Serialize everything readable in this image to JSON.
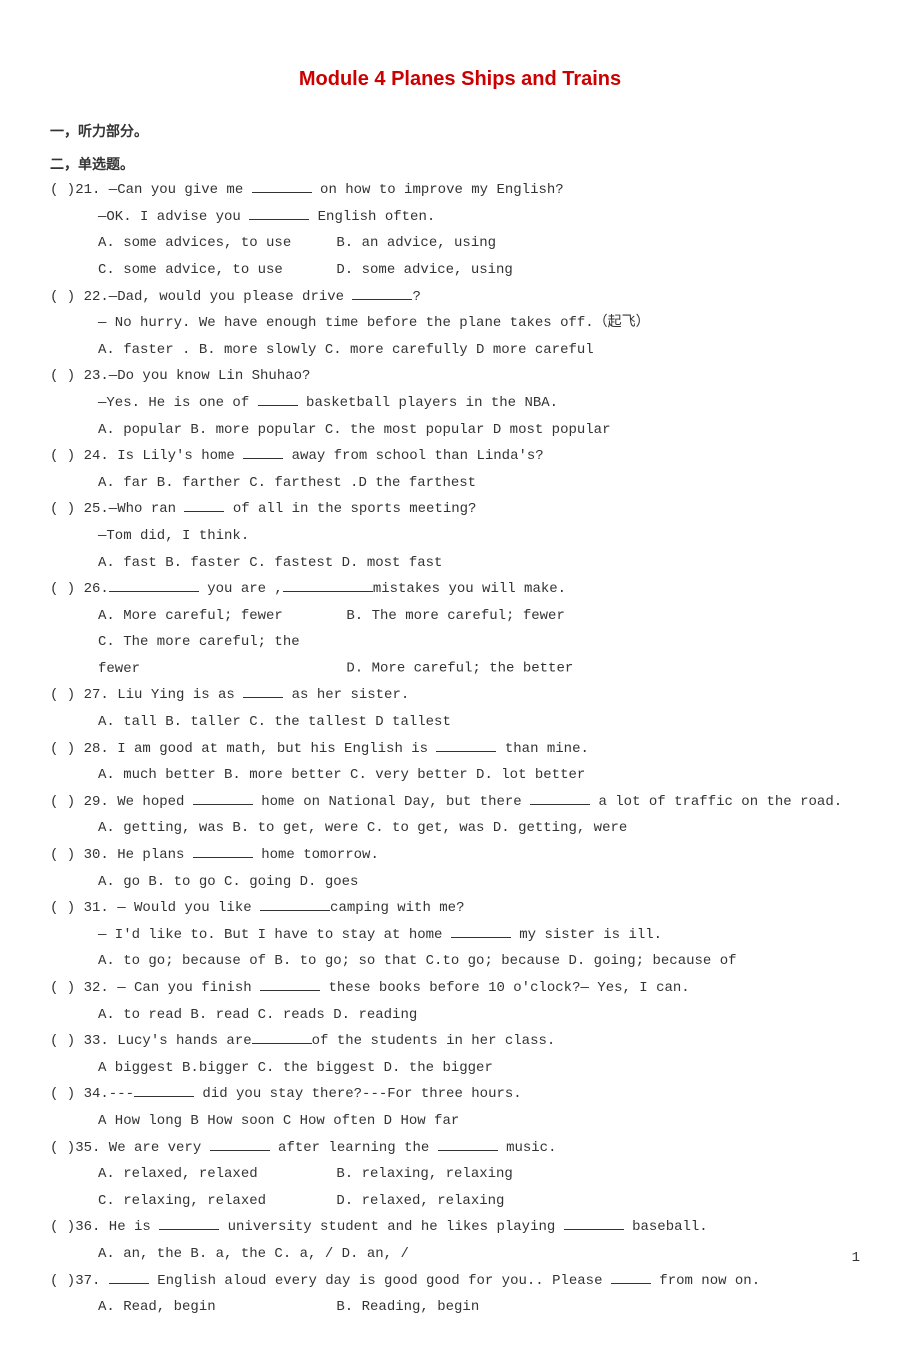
{
  "title": "Module 4 Planes Ships and Trains",
  "section1": "一，听力部分。",
  "section2": "二，单选题。",
  "q21": {
    "line1": "(   )21. —Can you give me ",
    "line1b": " on how to improve my English?",
    "line2": " —OK. I advise you ",
    "line2b": " English often.",
    "optA": "A. some advices, to use",
    "optB": "B. an advice, using",
    "optC": "C. some advice, to use",
    "optD": "D. some advice, using"
  },
  "q22": {
    "line1": "(   ) 22.—Dad, would you please drive ",
    "line1b": "?",
    "line2": " — No hurry. We have enough time before the plane takes off.（起飞）",
    "opts": "A. faster  . B. more slowly   C. more carefully  D  more careful"
  },
  "q23": {
    "line1": "(   ) 23.—Do you know Lin Shuhao?",
    "line2": " —Yes. He is one of ",
    "line2b": " basketball players in the NBA.",
    "opts": "A. popular   B. more popular  C. the most popular  D most popular"
  },
  "q24": {
    "line1": "(   ) 24. Is Lily's home ",
    "line1b": " away from school than Linda's?",
    "opts": " A. far   B.  farther   C. farthest .D  the farthest"
  },
  "q25": {
    "line1": "(   ) 25.—Who ran ",
    "line1b": " of all in the sports meeting?",
    "line2": "  —Tom did, I think.",
    "opts": "A. fast   B. faster   C. fastest   D. most fast"
  },
  "q26": {
    "line1": " (   ) 26.",
    "line1m": " you are ,",
    "line1b": "mistakes you will make.",
    "optA": "A. More careful; fewer",
    "optB": "B. The more careful; fewer",
    "optC": "C. The more careful; the fewer",
    "optD": "D. More careful; the better"
  },
  "q27": {
    "line1": "(   ) 27. Liu Ying is as ",
    "line1b": " as her sister.",
    "opts": " A. tall     B. taller   C. the tallest   D   tallest"
  },
  "q28": {
    "line1": "(   ) 28. I am good at math, but his English is ",
    "line1b": " than mine.",
    "opts": " A. much better   B. more better  C. very better    D. lot better"
  },
  "q29": {
    "line1": "(   ) 29. We hoped ",
    "line1m": " home on National Day, but there ",
    "line1b": " a lot of traffic on the road.",
    "opts": " A. getting, was  B. to get, were   C. to get, was   D. getting, were"
  },
  "q30": {
    "line1": "(  ) 30. He plans ",
    "line1b": " home tomorrow.",
    "opts": " A. go  B. to go    C. going  D. goes"
  },
  "q31": {
    "line1": "(  ) 31. — Would you like ",
    "line1b": "camping with me?",
    "line2": "  — I'd like to. But I have to stay at home ",
    "line2b": " my sister is ill.",
    "opts": "A. to go; because of   B. to go; so that   C.to go; because   D. going; because of"
  },
  "q32": {
    "line1": "(  ) 32. — Can you finish ",
    "line1b": " these books before 10 o'clock?— Yes, I can.",
    "opts": "A. to read      B. read      C. reads     D. reading"
  },
  "q33": {
    "line1": "(  ) 33. Lucy's hands are",
    "line1b": "of the students in her class.",
    "opts": "A biggest  B.bigger    C. the biggest   D. the bigger"
  },
  "q34": {
    "line1": "(  ) 34.---",
    "line1b": " did you stay there?---For three hours.",
    "opts": "A How long  B  How soon  C  How often  D  How far"
  },
  "q35": {
    "line1": "(  )35. We are very ",
    "line1m": " after learning the ",
    "line1b": " music.",
    "optA": "A. relaxed, relaxed",
    "optB": "B. relaxing, relaxing",
    "optC": "C. relaxing, relaxed",
    "optD": "D. relaxed, relaxing"
  },
  "q36": {
    "line1": "(  )36. He is ",
    "line1m": " university student and he likes playing ",
    "line1b": " baseball.",
    "opts": "A. an, the  B. a, the    C. a, /    D. an, /"
  },
  "q37": {
    "line1": "(  )37. ",
    "line1m": " English aloud every day is good good for you.. Please ",
    "line1b": " from now on.",
    "optA": "A. Read, begin",
    "optB": "B. Reading, begin"
  },
  "page_num": "1"
}
